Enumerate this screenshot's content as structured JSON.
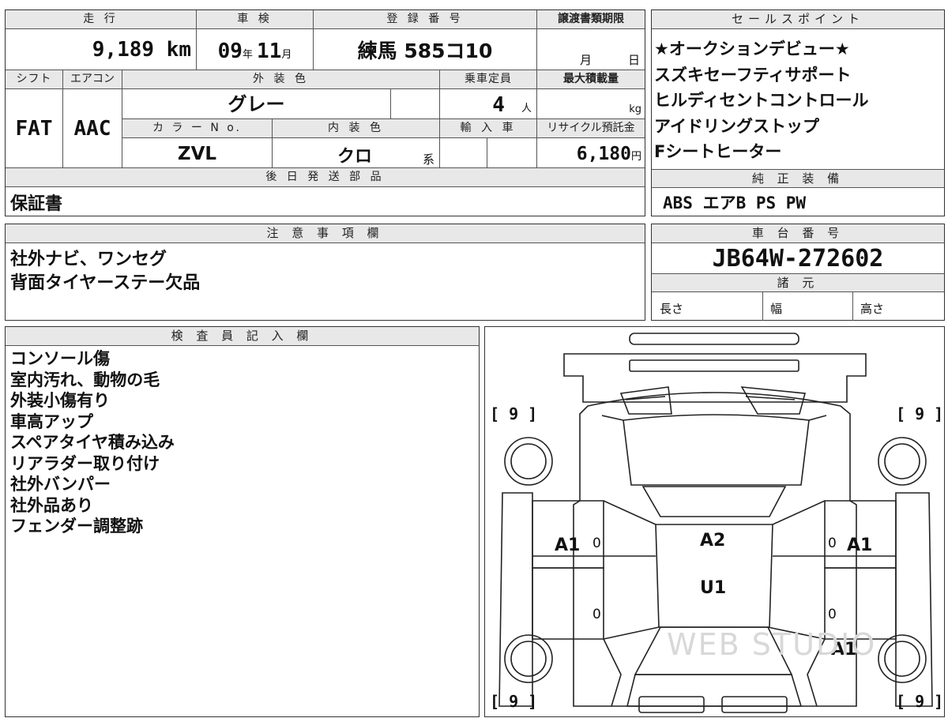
{
  "top": {
    "headers": {
      "mileage": "走 行",
      "shaken": "車 検",
      "registration": "登 録 番 号",
      "transfer_deadline": "譲渡書類期限",
      "shift": "シフト",
      "aircon": "エアコン",
      "exterior_color": "外 装 色",
      "capacity": "乗車定員",
      "max_load": "最大積載量",
      "color_no": "カ ラ ー N o.",
      "interior_color": "内 装 色",
      "import": "輸 入 車",
      "recycle": "リサイクル預託金"
    },
    "mileage_value": "9,189 km",
    "shaken_year": "09",
    "shaken_year_unit": "年",
    "shaken_month": "11",
    "shaken_month_unit": "月",
    "registration_value": "練馬 585コ10",
    "deadline_month_unit": "月",
    "deadline_day_unit": "日",
    "shift_value": "FAT",
    "aircon_value": "AAC",
    "exterior_value": "グレー",
    "capacity_value": "4",
    "capacity_unit": "人",
    "max_load_unit": "kg",
    "color_no_value": "ZVL",
    "interior_value": "クロ",
    "interior_suffix": "系",
    "recycle_value": "6,180",
    "recycle_unit": "円"
  },
  "sales": {
    "header": "セールスポイント",
    "lines": [
      "★オークションデビュー★",
      "スズキセーフティサポート",
      "ヒルディセントコントロール",
      "アイドリングストップ",
      "Fシートヒーター"
    ]
  },
  "later_parts": {
    "header": "後 日 発 送 部 品",
    "value": "保証書"
  },
  "equipment": {
    "header": "純 正 装 備",
    "value": "ABS エアB PS PW"
  },
  "notes": {
    "header": "注 意 事 項 欄",
    "lines": [
      "社外ナビ、ワンセグ",
      "背面タイヤーステー欠品"
    ]
  },
  "chassis": {
    "header": "車 台 番 号",
    "value": "JB64W-272602"
  },
  "specs": {
    "header": "諸 元",
    "length": "長さ",
    "width": "幅",
    "height": "高さ"
  },
  "inspector": {
    "header": "検 査 員 記 入 欄",
    "lines": [
      "コンソール傷",
      "室内汚れ、動物の毛",
      "外装小傷有り",
      "車高アップ",
      "スペアタイヤ積み込み",
      "リアラダー取り付け",
      "社外バンパー",
      "社外品あり",
      "フェンダー調整跡"
    ]
  },
  "diagram": {
    "tire_tl": "[ 9 ]",
    "tire_tr": "[ 9 ]",
    "tire_bl": "[ 9 ]",
    "tire_br": "[ 9 ]",
    "mark_left_door": "A1",
    "mark_right_door": "A1",
    "mark_roof_1": "A2",
    "mark_roof_2": "U1",
    "mark_right_rear": "A1",
    "zero": "0",
    "watermark": "WEB STUDIO"
  }
}
